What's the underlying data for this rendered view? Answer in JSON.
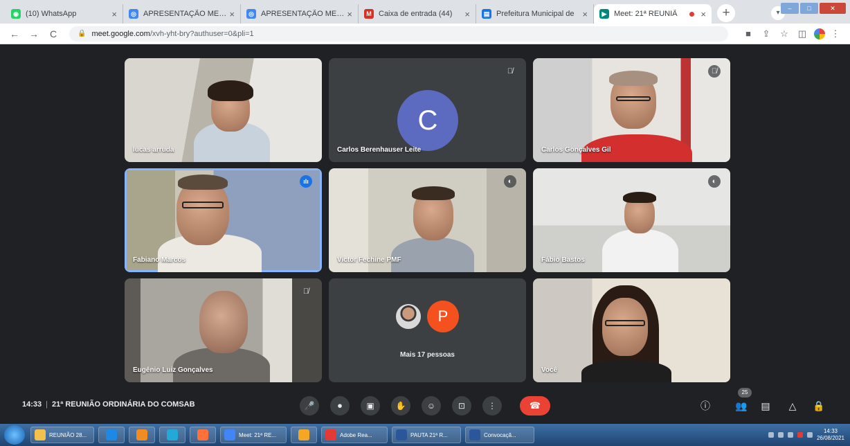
{
  "browser": {
    "tabs": [
      {
        "title": "(10) WhatsApp",
        "color": "#25d366",
        "glyph": "◉",
        "active": false
      },
      {
        "title": "APRESENTAÇÃO MEIO",
        "color": "#4285f4",
        "glyph": "◎",
        "active": false
      },
      {
        "title": "APRESENTAÇÃO MEIO",
        "color": "#4285f4",
        "glyph": "◎",
        "active": false
      },
      {
        "title": "Caixa de entrada (44)",
        "color": "#d93025",
        "glyph": "M",
        "active": false
      },
      {
        "title": "Prefeitura Municipal de",
        "color": "#1a73e8",
        "glyph": "▤",
        "active": false
      },
      {
        "title": "Meet: 21ª REUNIÃ",
        "color": "#00897b",
        "glyph": "▶",
        "active": true
      }
    ],
    "new_tab_label": "+",
    "url_host": "meet.google.com",
    "url_path": "/xvh-yht-bry?authuser=0&pli=1"
  },
  "participants": [
    {
      "name": "lucas arruda",
      "mic": "",
      "kind": "video",
      "speaking": false
    },
    {
      "name": "Carlos Berenhauser Leite",
      "mic": "muted",
      "kind": "avatar",
      "initial": "C",
      "speaking": false
    },
    {
      "name": "Carlos Gonçalves Gil",
      "mic": "muted",
      "kind": "video",
      "speaking": false
    },
    {
      "name": "Fabiano Marcos",
      "mic": "speaking",
      "kind": "video",
      "speaking": true
    },
    {
      "name": "Victor Fechine PMF",
      "mic": "idle",
      "kind": "video",
      "speaking": false
    },
    {
      "name": "Fábio Bastos",
      "mic": "idle",
      "kind": "video",
      "speaking": false
    },
    {
      "name": "Eugênio Luiz Gonçalves",
      "mic": "muted",
      "kind": "video",
      "speaking": false
    },
    {
      "name": "Mais 17 pessoas",
      "mic": "",
      "kind": "more",
      "initial": "P",
      "speaking": false
    },
    {
      "name": "Você",
      "mic": "",
      "kind": "video",
      "speaking": false
    }
  ],
  "meeting": {
    "time": "14:33",
    "separator": "|",
    "title": "21ª REUNIÃO ORDINÁRIA DO COMSAB",
    "participant_count": "25"
  },
  "controls": {
    "mic_icon": "🎤",
    "camera_icon": "⏺",
    "captions_icon": "▣",
    "raise_hand_icon": "✋",
    "emoji_icon": "☺",
    "present_icon": "⊡",
    "more_icon": "⋮",
    "hangup_icon": "☎"
  },
  "taskbar": {
    "items": [
      {
        "label": "REUNIÃO 28...",
        "color": "#f2c14e"
      },
      {
        "label": "",
        "color": "#1e88e5"
      },
      {
        "label": "",
        "color": "#f28b20"
      },
      {
        "label": "",
        "color": "#23a9d6"
      },
      {
        "label": "",
        "color": "#ff7139"
      },
      {
        "label": "Meet: 21ª RE...",
        "color": "#4285f4"
      },
      {
        "label": "",
        "color": "#f6a623"
      },
      {
        "label": "Adobe Rea...",
        "color": "#e53935"
      },
      {
        "label": "PAUTA 21ª R...",
        "color": "#2b579a"
      },
      {
        "label": "Convocaçã...",
        "color": "#2b579a"
      }
    ],
    "clock_time": "14:33",
    "clock_date": "26/08/2021"
  }
}
